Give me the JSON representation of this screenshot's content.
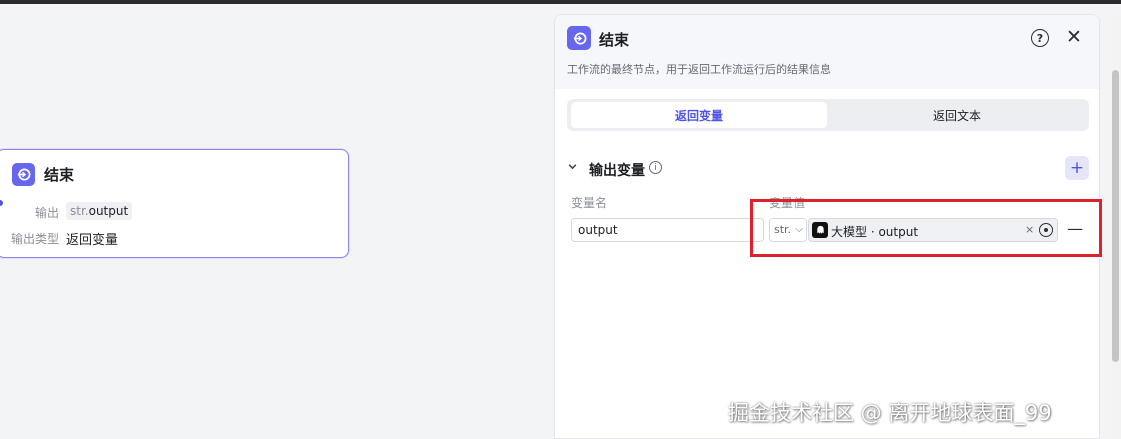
{
  "node": {
    "title": "结束",
    "output_label": "输出",
    "output_type": "str.",
    "output_value": "output",
    "output_kind_label": "输出类型",
    "output_kind_value": "返回变量"
  },
  "panel": {
    "title": "结束",
    "help": "?",
    "close": "✕",
    "description": "工作流的最终节点，用于返回工作流运行后的结果信息",
    "tabs": [
      {
        "label": "返回变量",
        "active": true
      },
      {
        "label": "返回文本",
        "active": false
      }
    ],
    "section": {
      "title": "输出变量",
      "add": "+",
      "col_name": "变量名",
      "col_value": "变量值",
      "row": {
        "name": "output",
        "type": "str.",
        "ref_text": "大模型 · output",
        "clear": "×",
        "remove": "—"
      }
    }
  },
  "highlight_color": "#e0202c",
  "accent_color": "#4d53e8",
  "watermark": "掘金技术社区 @ 离开地球表面_99"
}
